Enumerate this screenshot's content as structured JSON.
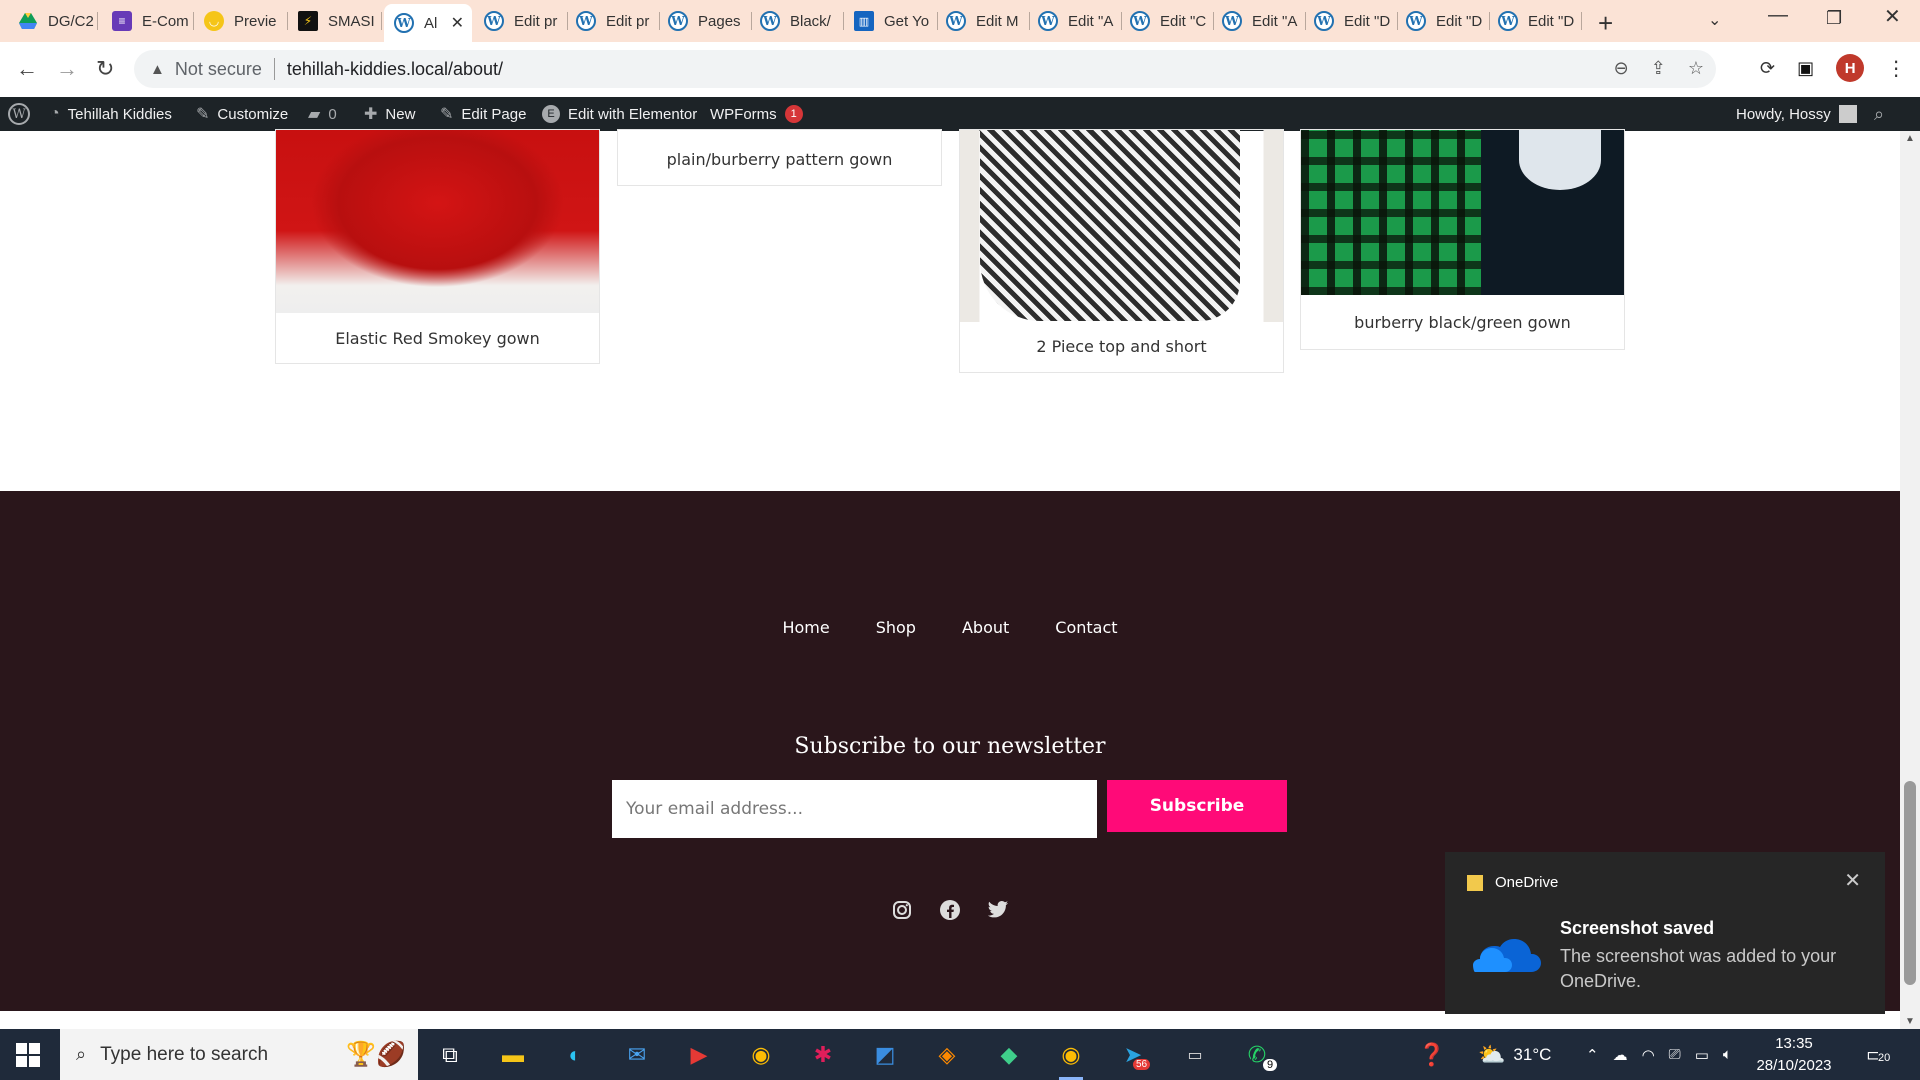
{
  "browser": {
    "tabs": [
      {
        "label": "DG/C2",
        "icon": "google-drive-icon"
      },
      {
        "label": "E-Com",
        "icon": "forms-icon"
      },
      {
        "label": "Previe",
        "icon": "preview-icon"
      },
      {
        "label": "SMASI",
        "icon": "smashing-icon"
      },
      {
        "label": "Al",
        "icon": "wordpress-icon",
        "active": true
      },
      {
        "label": "Edit pr",
        "icon": "wordpress-icon"
      },
      {
        "label": "Edit pr",
        "icon": "wordpress-icon"
      },
      {
        "label": "Pages",
        "icon": "wordpress-icon"
      },
      {
        "label": "Black/",
        "icon": "wordpress-icon"
      },
      {
        "label": "Get Yo",
        "icon": "bank-icon"
      },
      {
        "label": "Edit M",
        "icon": "wordpress-icon"
      },
      {
        "label": "Edit \"A",
        "icon": "wordpress-icon"
      },
      {
        "label": "Edit \"C",
        "icon": "wordpress-icon"
      },
      {
        "label": "Edit \"A",
        "icon": "wordpress-icon"
      },
      {
        "label": "Edit \"D",
        "icon": "wordpress-icon"
      },
      {
        "label": "Edit \"D",
        "icon": "wordpress-icon"
      },
      {
        "label": "Edit \"D",
        "icon": "wordpress-icon"
      }
    ],
    "security_label": "Not secure",
    "url": "tehillah-kiddies.local/about/",
    "profile_initial": "H"
  },
  "admin_bar": {
    "site_name": "Tehillah Kiddies",
    "customize": "Customize",
    "comments_count": "0",
    "new": "New",
    "edit_page": "Edit Page",
    "elementor": "Edit with Elementor",
    "wpforms": "WPForms",
    "wpforms_badge": "1",
    "howdy": "Howdy, Hossy"
  },
  "products": [
    {
      "caption": "Elastic Red Smokey gown"
    },
    {
      "caption": "plain/burberry pattern gown"
    },
    {
      "caption": "2 Piece top and short"
    },
    {
      "caption": "burberry black/green gown"
    }
  ],
  "footer": {
    "nav": [
      "Home",
      "Shop",
      "About",
      "Contact"
    ],
    "newsletter_title": "Subscribe to our newsletter",
    "email_placeholder": "Your email address...",
    "subscribe_label": "Subscribe",
    "social": [
      "instagram-icon",
      "facebook-icon",
      "twitter-icon"
    ]
  },
  "toast": {
    "app": "OneDrive",
    "title": "Screenshot saved",
    "body": "The screenshot was added to your OneDrive."
  },
  "taskbar": {
    "search_placeholder": "Type here to search",
    "temperature": "31°C",
    "time": "13:35",
    "date": "28/10/2023",
    "notifications": "20",
    "telegram_badge": "56",
    "whatsapp_badge": "9"
  },
  "colors": {
    "footer_bg": "#2a161b",
    "subscribe_bg": "#ff0a78",
    "admin_bar_bg": "#1d2327",
    "tabstrip_bg": "#fbe3d6"
  }
}
